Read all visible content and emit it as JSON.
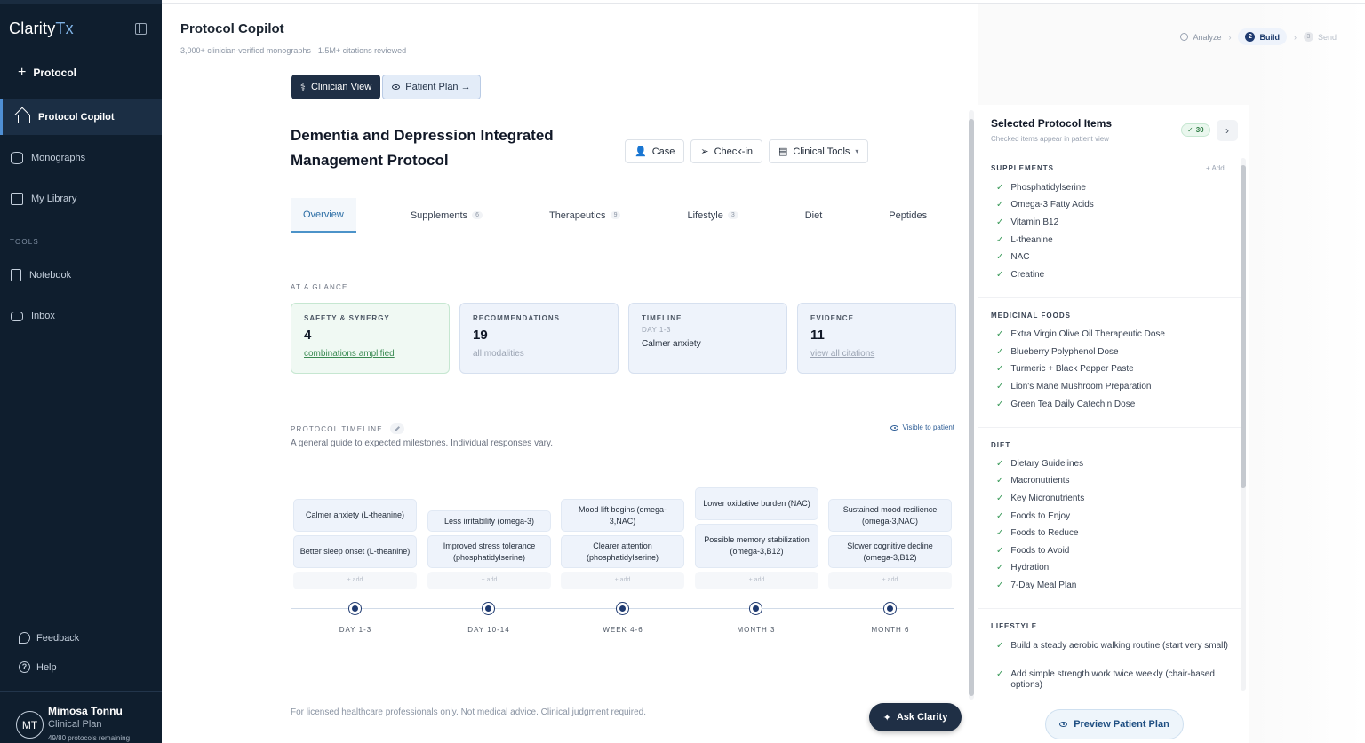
{
  "sidebar": {
    "brand_main": "Clarity",
    "brand_accent": "Tx",
    "new_protocol": "Protocol",
    "nav": [
      {
        "label": "Protocol Copilot",
        "icon": "home-icon"
      },
      {
        "label": "Monographs",
        "icon": "database-icon"
      },
      {
        "label": "My Library",
        "icon": "library-icon"
      }
    ],
    "tools_label": "TOOLS",
    "tools": [
      {
        "label": "Notebook",
        "icon": "notebook-icon"
      },
      {
        "label": "Inbox",
        "icon": "inbox-icon"
      }
    ],
    "feedback": "Feedback",
    "help": "Help",
    "user": {
      "initials": "MT",
      "name": "Mimosa Tonnu",
      "role": "Clinical Plan",
      "quota": "49/80 protocols remaining"
    }
  },
  "header": {
    "title": "Protocol Copilot",
    "subtitle": "3,000+ clinician-verified monographs · 1.5M+ citations reviewed",
    "steps": [
      {
        "label": "Analyze",
        "state": "done"
      },
      {
        "num": "2",
        "label": "Build",
        "state": "active"
      },
      {
        "num": "3",
        "label": "Send",
        "state": "upcoming"
      }
    ]
  },
  "view_toggle": {
    "clinician": "Clinician View",
    "patient": "Patient Plan →"
  },
  "protocol": {
    "title": "Dementia and Depression Integrated Management Protocol",
    "actions": {
      "case": "Case",
      "checkin": "Check-in",
      "tools": "Clinical Tools"
    }
  },
  "tabs": [
    {
      "label": "Overview",
      "count": ""
    },
    {
      "label": "Supplements",
      "count": "6"
    },
    {
      "label": "Therapeutics",
      "count": "9"
    },
    {
      "label": "Lifestyle",
      "count": "3"
    },
    {
      "label": "Diet",
      "count": ""
    },
    {
      "label": "Peptides",
      "count": ""
    }
  ],
  "glance": {
    "label": "AT A GLANCE",
    "safety": {
      "label": "SAFETY & SYNERGY",
      "value": "4",
      "link": "combinations amplified"
    },
    "recommendations": {
      "label": "RECOMMENDATIONS",
      "value": "19",
      "note": "all modalities"
    },
    "timeline": {
      "label": "TIMELINE",
      "period": "DAY 1-3",
      "text": "Calmer anxiety"
    },
    "evidence": {
      "label": "EVIDENCE",
      "value": "11",
      "link": "view all citations"
    }
  },
  "timeline": {
    "label": "PROTOCOL TIMELINE",
    "subtitle": "A general guide to expected milestones. Individual responses vary.",
    "visible": "Visible to patient",
    "add_label": "+ add",
    "columns": [
      {
        "tick": "DAY 1-3",
        "items": [
          "Calmer anxiety (L-theanine)",
          "Better sleep onset (L-theanine)"
        ]
      },
      {
        "tick": "DAY 10-14",
        "items": [
          "Less irritability (omega-3)",
          "Improved stress tolerance (phosphatidylserine)"
        ]
      },
      {
        "tick": "WEEK 4-6",
        "items": [
          "Mood lift begins (omega-3,NAC)",
          "Clearer attention (phosphatidylserine)"
        ]
      },
      {
        "tick": "MONTH 3",
        "items": [
          "Lower oxidative burden (NAC)",
          "Possible memory stabilization (omega-3,B12)"
        ]
      },
      {
        "tick": "MONTH 6",
        "items": [
          "Sustained mood resilience (omega-3,NAC)",
          "Slower cognitive decline (omega-3,B12)"
        ]
      }
    ]
  },
  "disclaimer": "For licensed healthcare professionals only. Not medical advice. Clinical judgment required.",
  "ask_button": "Ask Clarity",
  "right_panel": {
    "title": "Selected Protocol Items",
    "subtitle": "Checked items appear in patient view",
    "count": "30",
    "add_label": "+ Add",
    "sections": [
      {
        "label": "SUPPLEMENTS",
        "items": [
          "Phosphatidylserine",
          "Omega-3 Fatty Acids",
          "Vitamin B12",
          "L-theanine",
          "NAC",
          "Creatine"
        ]
      },
      {
        "label": "MEDICINAL FOODS",
        "items": [
          "Extra Virgin Olive Oil Therapeutic Dose",
          "Blueberry Polyphenol Dose",
          "Turmeric + Black Pepper Paste",
          "Lion's Mane Mushroom Preparation",
          "Green Tea Daily Catechin Dose"
        ]
      },
      {
        "label": "DIET",
        "items": [
          "Dietary Guidelines",
          "Macronutrients",
          "Key Micronutrients",
          "Foods to Enjoy",
          "Foods to Reduce",
          "Foods to Avoid",
          "Hydration",
          "7-Day Meal Plan"
        ]
      },
      {
        "label": "LIFESTYLE",
        "items": [
          "Build a steady aerobic walking routine (start very small)",
          "Add simple strength work twice weekly (chair-based options)"
        ]
      }
    ],
    "preview_button": "Preview Patient Plan"
  },
  "colors": {
    "sidebar_bg": "#0f1e2e",
    "accent": "#1f3a70",
    "success": "#3a9a5a"
  }
}
